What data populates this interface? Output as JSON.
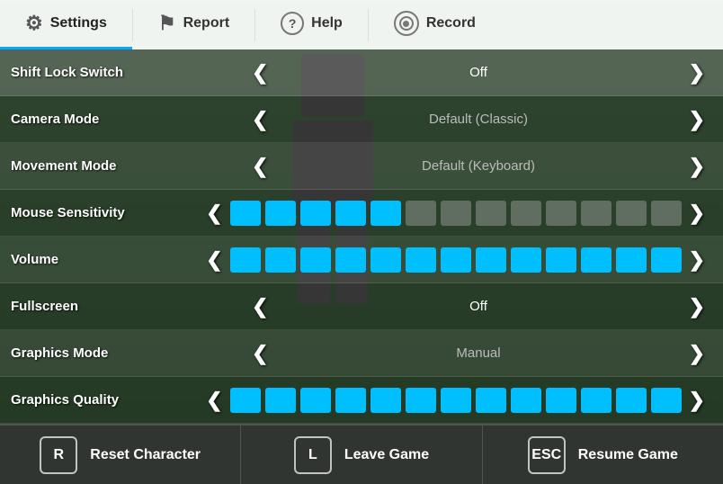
{
  "nav": {
    "items": [
      {
        "id": "settings",
        "label": "Settings",
        "icon": "⚙",
        "active": true
      },
      {
        "id": "report",
        "label": "Report",
        "icon": "⚑",
        "active": false
      },
      {
        "id": "help",
        "label": "Help",
        "icon": "?",
        "active": false
      },
      {
        "id": "record",
        "label": "Record",
        "icon": "◎",
        "active": false
      }
    ]
  },
  "settings": [
    {
      "id": "shift-lock-switch",
      "label": "Shift Lock Switch",
      "type": "value",
      "value": "Off",
      "value_class": "white"
    },
    {
      "id": "camera-mode",
      "label": "Camera Mode",
      "type": "value",
      "value": "Default (Classic)",
      "value_class": ""
    },
    {
      "id": "movement-mode",
      "label": "Movement Mode",
      "type": "value",
      "value": "Default (Keyboard)",
      "value_class": ""
    },
    {
      "id": "mouse-sensitivity",
      "label": "Mouse Sensitivity",
      "type": "slider",
      "filled": 5,
      "total": 13
    },
    {
      "id": "volume",
      "label": "Volume",
      "type": "slider",
      "filled": 13,
      "total": 13
    },
    {
      "id": "fullscreen",
      "label": "Fullscreen",
      "type": "value",
      "value": "Off",
      "value_class": "white"
    },
    {
      "id": "graphics-mode",
      "label": "Graphics Mode",
      "type": "value",
      "value": "Manual",
      "value_class": ""
    },
    {
      "id": "graphics-quality",
      "label": "Graphics Quality",
      "type": "slider",
      "filled": 13,
      "total": 13
    }
  ],
  "bottom_buttons": [
    {
      "id": "reset-character",
      "key": "R",
      "label": "Reset Character"
    },
    {
      "id": "leave-game",
      "key": "L",
      "label": "Leave Game"
    },
    {
      "id": "resume-game",
      "key": "ESC",
      "label": "Resume Game"
    }
  ],
  "icons": {
    "settings": "⚙",
    "report": "⚑",
    "help": "?",
    "record": "◎",
    "left_arrow": "❮",
    "right_arrow": "❯"
  }
}
